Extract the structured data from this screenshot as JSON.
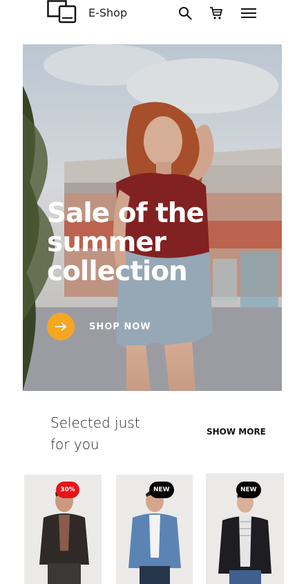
{
  "header": {
    "brand": "E-Shop",
    "icons": [
      "devices-logo-icon",
      "search-icon",
      "cart-icon",
      "menu-icon"
    ]
  },
  "hero": {
    "title_lines": [
      "Sale of the",
      "summer",
      "collection"
    ],
    "cta_label": "SHOP NOW",
    "accent": "#f5a623"
  },
  "section": {
    "title_lines": [
      "Selected just",
      "for you"
    ],
    "show_more": "SHOW MORE"
  },
  "products": [
    {
      "badge": "30%",
      "badge_color": "#e8141b"
    },
    {
      "badge": "NEW",
      "badge_color": "#000000"
    },
    {
      "badge": "NEW",
      "badge_color": "#000000"
    }
  ]
}
